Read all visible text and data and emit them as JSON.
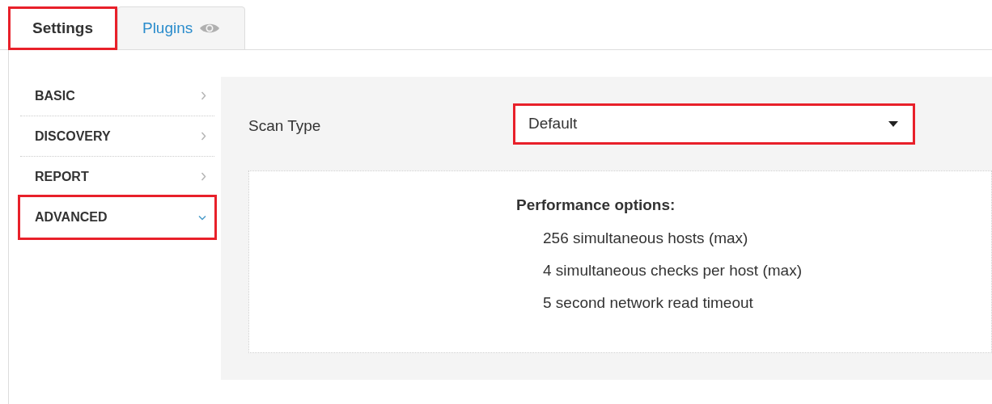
{
  "tabs": [
    {
      "label": "Settings",
      "selected": true,
      "highlighted": true
    },
    {
      "label": "Plugins",
      "selected": false,
      "highlighted": false
    }
  ],
  "sidebar": {
    "items": [
      {
        "label": "BASIC",
        "expanded": false,
        "highlighted": false
      },
      {
        "label": "DISCOVERY",
        "expanded": false,
        "highlighted": false
      },
      {
        "label": "REPORT",
        "expanded": false,
        "highlighted": false
      },
      {
        "label": "ADVANCED",
        "expanded": true,
        "highlighted": true
      }
    ]
  },
  "scan_type": {
    "label": "Scan Type",
    "value": "Default",
    "highlighted": true
  },
  "performance": {
    "heading": "Performance options:",
    "lines": [
      "256 simultaneous hosts (max)",
      "4 simultaneous checks per host (max)",
      "5 second network read timeout"
    ]
  }
}
